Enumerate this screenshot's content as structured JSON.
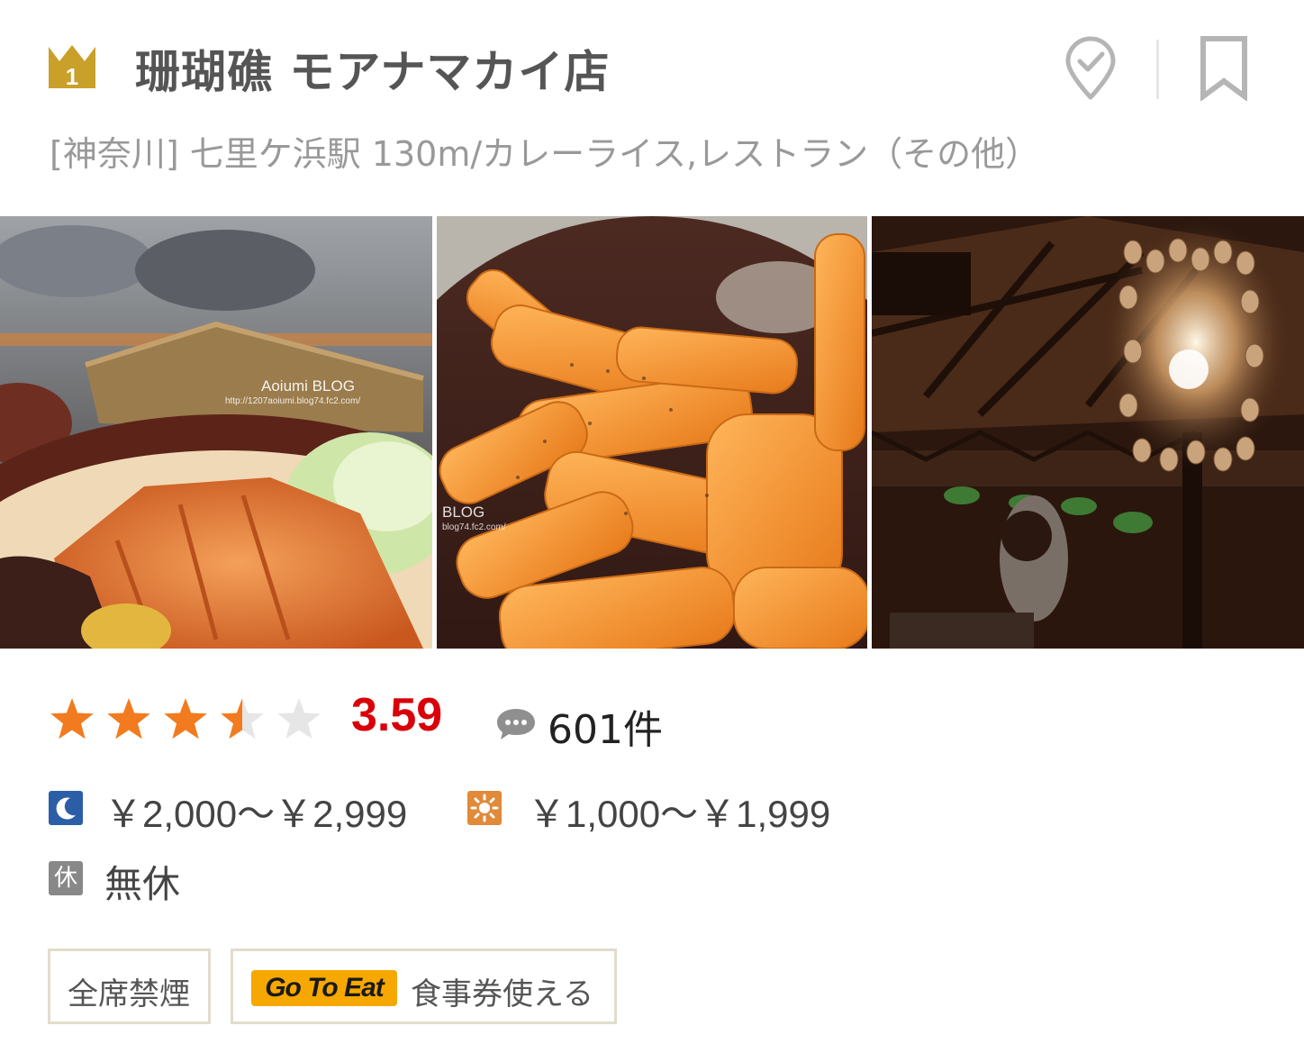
{
  "restaurant": {
    "rank": "1",
    "name": "珊瑚礁 モアナマカイ店",
    "subtitle": "[神奈川] 七里ケ浜駅 130m/カレーライス,レストラン（その他）"
  },
  "photos": [
    {
      "icon": "photo-katsu-curry",
      "watermark_title": "Aoiumi BLOG",
      "watermark_url": "http://1207aoiumi.blog74.fc2.com/"
    },
    {
      "icon": "photo-fries",
      "watermark_title": "BLOG",
      "watermark_url": "blog74.fc2.com/"
    },
    {
      "icon": "photo-interior"
    }
  ],
  "rating": {
    "stars": 3.5,
    "max_stars": 5,
    "score": "3.59",
    "review_count": "601件"
  },
  "price": {
    "dinner": "￥2,000～￥2,999",
    "lunch": "￥1,000～￥1,999"
  },
  "holiday": {
    "icon_label": "休",
    "text": "無休"
  },
  "tags": {
    "smoking": "全席禁煙",
    "goto_logo": "Go To Eat",
    "goto_text": "食事券使える"
  },
  "colors": {
    "star": "#f27b1f",
    "star_empty": "#e6e6e6",
    "score": "#d9000a",
    "rank_gold": "#c8a02a",
    "dinner_icon": "#2c5ea8",
    "lunch_icon": "#e08a3a",
    "goto": "#f6a800"
  }
}
